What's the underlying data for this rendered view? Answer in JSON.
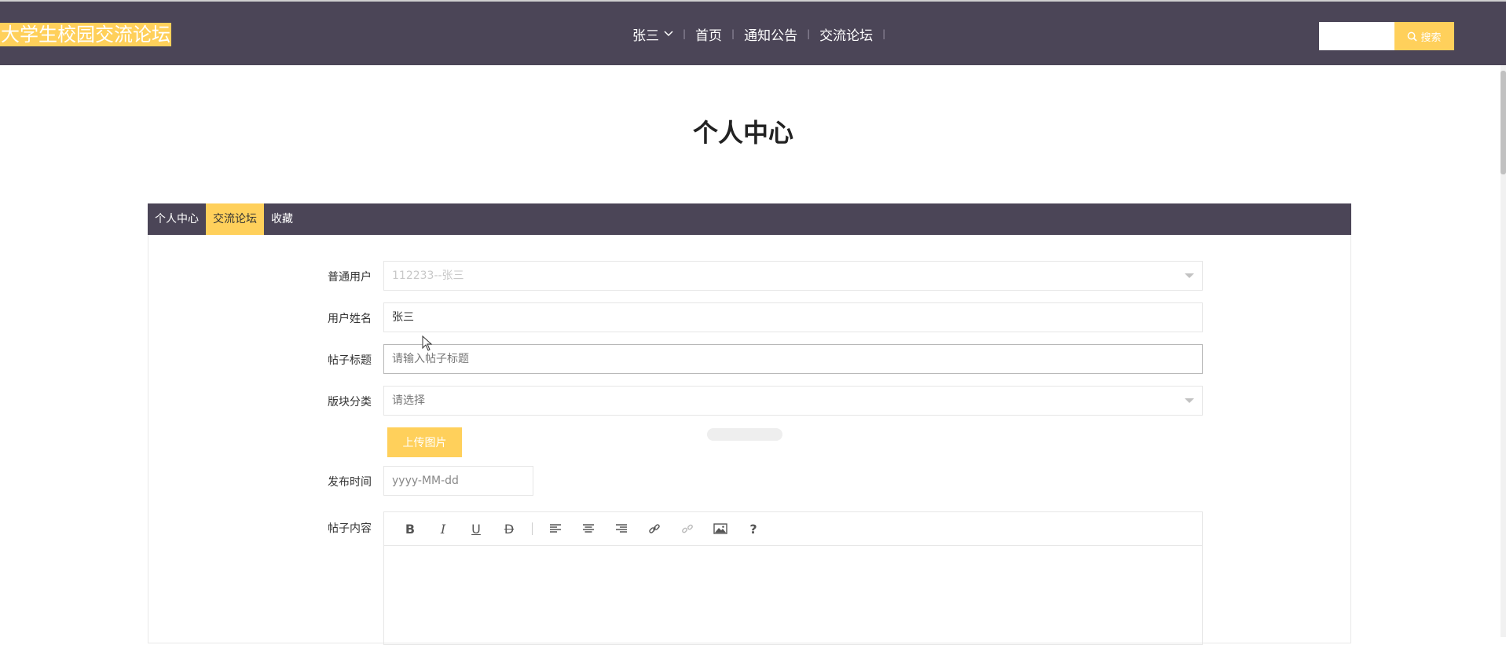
{
  "header": {
    "site_title": "大学生校园交流论坛",
    "user_name": "张三",
    "nav": [
      "首页",
      "通知公告",
      "交流论坛"
    ],
    "search_placeholder": "",
    "search_button": "搜索"
  },
  "page_title": "个人中心",
  "tabs": [
    {
      "label": "个人中心",
      "active": false
    },
    {
      "label": "交流论坛",
      "active": true
    },
    {
      "label": "收藏",
      "active": false
    }
  ],
  "form": {
    "user_type_label": "普通用户",
    "user_type_value": "112233--张三",
    "username_label": "用户姓名",
    "username_value": "张三",
    "post_title_label": "帖子标题",
    "post_title_placeholder": "请输入帖子标题",
    "category_label": "版块分类",
    "category_value": "请选择",
    "upload_button": "上传图片",
    "publish_time_label": "发布时间",
    "publish_time_placeholder": "yyyy-MM-dd",
    "content_label": "帖子内容"
  },
  "editor_tools": [
    "bold-icon",
    "italic-icon",
    "underline-icon",
    "strikethrough-icon",
    "align-left-icon",
    "align-center-icon",
    "align-right-icon",
    "link-icon",
    "unlink-icon",
    "image-icon",
    "help-icon"
  ],
  "colors": {
    "header_bg": "#4b4557",
    "accent": "#ffd05b"
  }
}
